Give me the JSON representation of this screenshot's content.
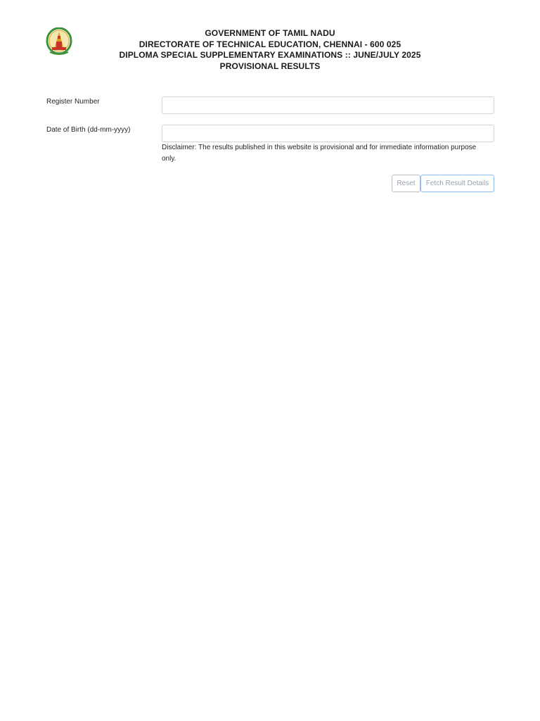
{
  "header": {
    "line1": "GOVERNMENT OF TAMIL NADU",
    "line2": "DIRECTORATE OF TECHNICAL EDUCATION, CHENNAI - 600 025",
    "line3": "DIPLOMA SPECIAL SUPPLEMENTARY EXAMINATIONS :: JUNE/JULY 2025",
    "line4": "PROVISIONAL RESULTS",
    "emblem_icon": "tamil-nadu-emblem-icon"
  },
  "form": {
    "register_number": {
      "label": "Register Number",
      "value": ""
    },
    "dob": {
      "label": "Date of Birth (dd-mm-yyyy)",
      "value": ""
    },
    "disclaimer": "Disclaimer: The results published in this website is provisional and for immediate information purpose only.",
    "reset_label": "Reset",
    "fetch_label": "Fetch Result Details"
  },
  "colors": {
    "input_border": "#ced4da",
    "button_text_disabled": "#9aa3ab",
    "fetch_border": "#8cbcf2",
    "emblem_green": "#3f8f3a",
    "emblem_red": "#c8342a",
    "emblem_gold": "#e0a21c"
  }
}
